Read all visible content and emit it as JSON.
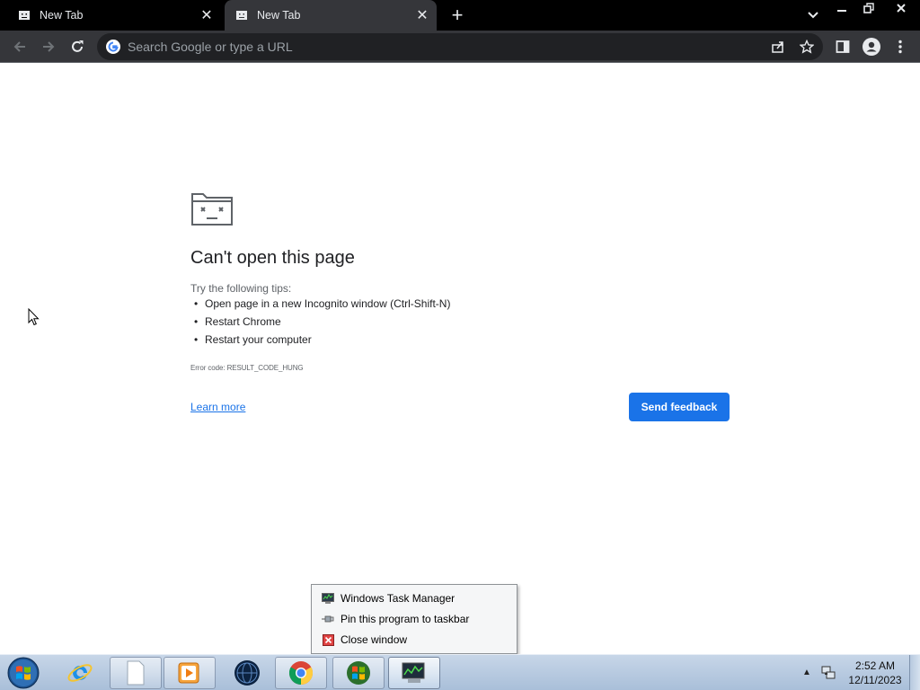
{
  "browser": {
    "tabs": [
      {
        "title": "New Tab",
        "active": false
      },
      {
        "title": "New Tab",
        "active": true
      }
    ],
    "omnibox": {
      "placeholder": "Search Google or type a URL",
      "value": ""
    }
  },
  "error_page": {
    "heading": "Can't open this page",
    "tips_intro": "Try the following tips:",
    "tips": [
      "Open page in a new Incognito window (Ctrl-Shift-N)",
      "Restart Chrome",
      "Restart your computer"
    ],
    "error_code": "Error code: RESULT_CODE_HUNG",
    "learn_more": "Learn more",
    "send_feedback": "Send feedback"
  },
  "jumplist": {
    "items": [
      {
        "label": "Windows Task Manager",
        "icon": "task-manager-icon"
      },
      {
        "label": "Pin this program to taskbar",
        "icon": "pin-icon"
      },
      {
        "label": "Close window",
        "icon": "close-window-icon"
      }
    ]
  },
  "taskbar": {
    "apps": [
      {
        "name": "internet-explorer",
        "icon": "internet-explorer-icon"
      },
      {
        "name": "file-explorer",
        "icon": "folder-icon"
      },
      {
        "name": "media-player",
        "icon": "media-player-icon"
      },
      {
        "name": "globe-app",
        "icon": "globe-icon"
      },
      {
        "name": "chrome",
        "icon": "chrome-icon"
      },
      {
        "name": "windows-flag-app",
        "icon": "windows-flag-icon"
      },
      {
        "name": "task-manager",
        "icon": "task-manager-icon"
      }
    ],
    "clock": {
      "time": "2:52 AM",
      "date": "12/11/2023"
    }
  },
  "colors": {
    "accent": "#1a73e8",
    "tabstrip": "#000000",
    "toolbar": "#35363a",
    "omnibox": "#202124"
  }
}
